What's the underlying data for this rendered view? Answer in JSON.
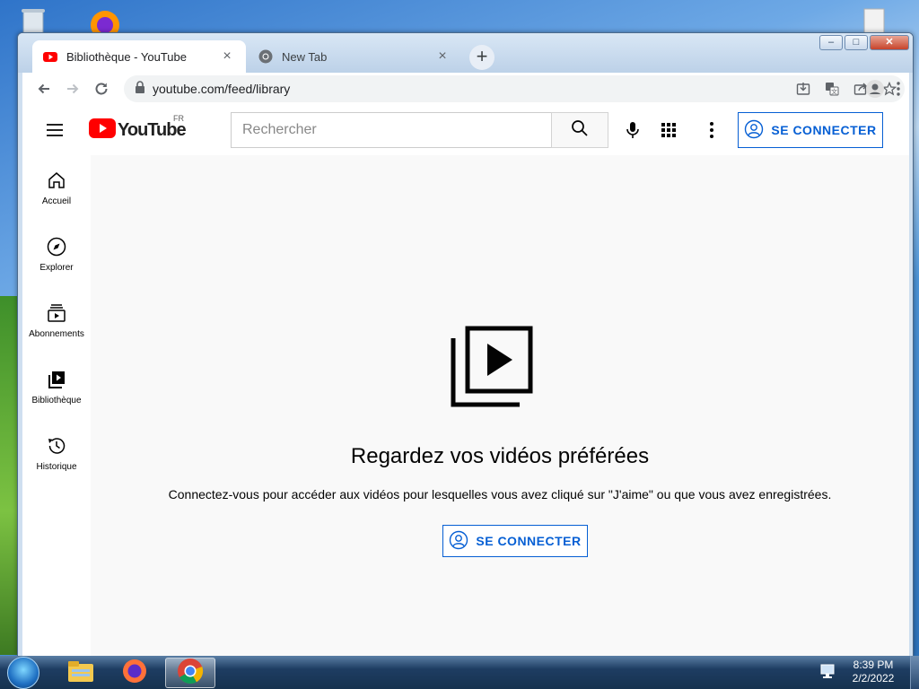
{
  "browser": {
    "tabs": [
      {
        "label": "Bibliothèque - YouTube",
        "icon": "youtube-favicon",
        "active": true
      },
      {
        "label": "New Tab",
        "icon": "chrome-favicon",
        "active": false
      }
    ],
    "close_glyph": "×",
    "new_tab_glyph": "+",
    "url": "youtube.com/feed/library",
    "window_controls": {
      "minimize": "–",
      "maximize": "□",
      "close": "✕"
    }
  },
  "youtube": {
    "logo_text": "YouTube",
    "country_code": "FR",
    "search_placeholder": "Rechercher",
    "signin_label": "SE CONNECTER",
    "guide": [
      {
        "label": "Accueil",
        "icon": "home-icon"
      },
      {
        "label": "Explorer",
        "icon": "compass-icon"
      },
      {
        "label": "Abonnements",
        "icon": "subscriptions-icon"
      },
      {
        "label": "Bibliothèque",
        "icon": "library-icon"
      },
      {
        "label": "Historique",
        "icon": "history-icon"
      }
    ],
    "empty_title": "Regardez vos vidéos préférées",
    "empty_subtitle": "Connectez-vous pour accéder aux vidéos pour lesquelles vous avez cliqué sur \"J'aime\" ou que vous avez enregistrées."
  },
  "taskbar": {
    "apps": [
      "file-explorer-icon",
      "firefox-icon",
      "chrome-icon"
    ],
    "time": "8:39 PM",
    "date": "2/2/2022"
  },
  "colors": {
    "youtube_red": "#ff0000",
    "signin_blue": "#065fd4"
  }
}
